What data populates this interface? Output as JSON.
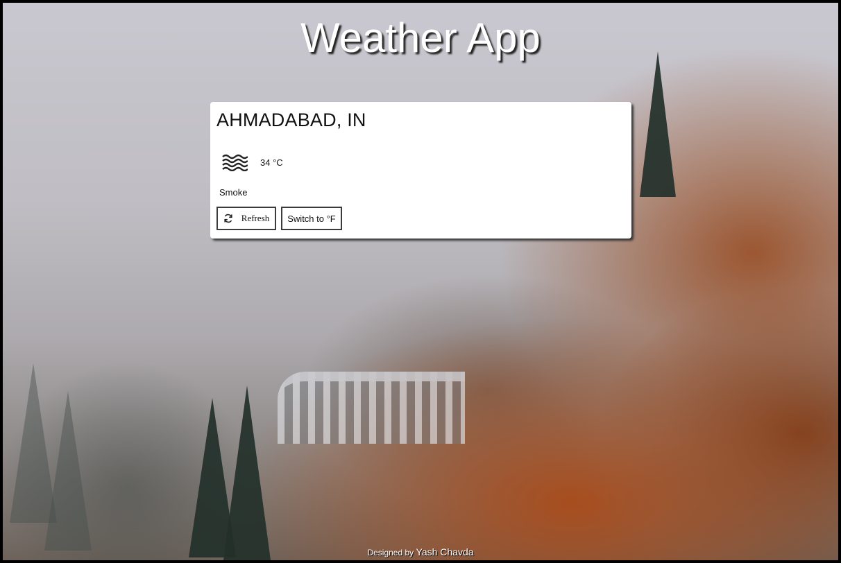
{
  "app": {
    "title": "Weather App"
  },
  "weather_card": {
    "location": "AHMADABAD, IN",
    "temperature": "34 °C",
    "description": "Smoke",
    "icon": "smoke-waves-icon",
    "refresh_label": "Refresh",
    "refresh_icon": "refresh-icon",
    "unit_toggle_label": "Switch to °F"
  },
  "footer": {
    "prefix": "Designed by",
    "author": "Yash Chavda"
  },
  "colors": {
    "card_background": "#ffffff",
    "button_border": "#3b3b3b",
    "title_text": "#ffffff"
  }
}
